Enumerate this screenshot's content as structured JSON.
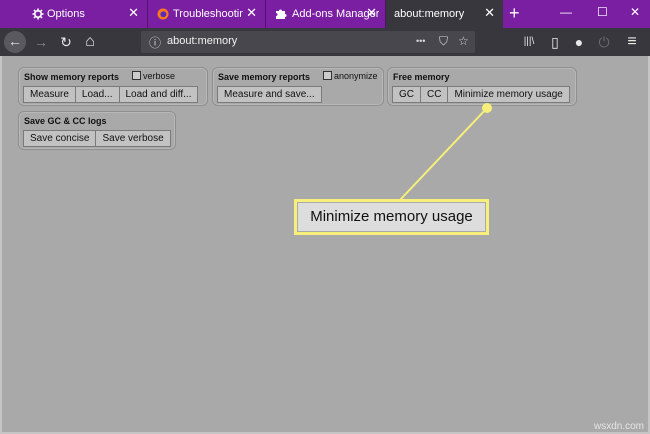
{
  "tabs": [
    {
      "title": "Options",
      "icon": "gear-icon"
    },
    {
      "title": "Troubleshooting I",
      "icon": "firefox-icon"
    },
    {
      "title": "Add-ons Manager",
      "icon": "puzzle-icon"
    },
    {
      "title": "about:memory",
      "active": true
    }
  ],
  "tab_close": "✕",
  "new_tab": "+",
  "window": {
    "minimize": "—",
    "maximize": "☐",
    "close": "✕"
  },
  "nav": {
    "back": "←",
    "forward": "→",
    "reload": "↻",
    "home": "⌂",
    "url": "about:memory",
    "info": "ⓘ",
    "more": "•••",
    "pocket": "⛉",
    "star": "☆",
    "library": "|||\\",
    "sidebar": "▯",
    "account": "●",
    "sync": "⏻",
    "menu": "≡"
  },
  "panels": {
    "show_reports": {
      "title": "Show memory reports",
      "checkbox": "verbose",
      "buttons": [
        "Measure",
        "Load...",
        "Load and diff..."
      ]
    },
    "save_reports": {
      "title": "Save memory reports",
      "checkbox": "anonymize",
      "buttons": [
        "Measure and save..."
      ]
    },
    "free_memory": {
      "title": "Free memory",
      "buttons": [
        "GC",
        "CC",
        "Minimize memory usage"
      ]
    },
    "gc_logs": {
      "title": "Save GC & CC logs",
      "buttons": [
        "Save concise",
        "Save verbose"
      ]
    }
  },
  "callout": {
    "label": "Minimize memory usage",
    "color": "#f6f07a"
  },
  "watermark": "wsxdn.com"
}
